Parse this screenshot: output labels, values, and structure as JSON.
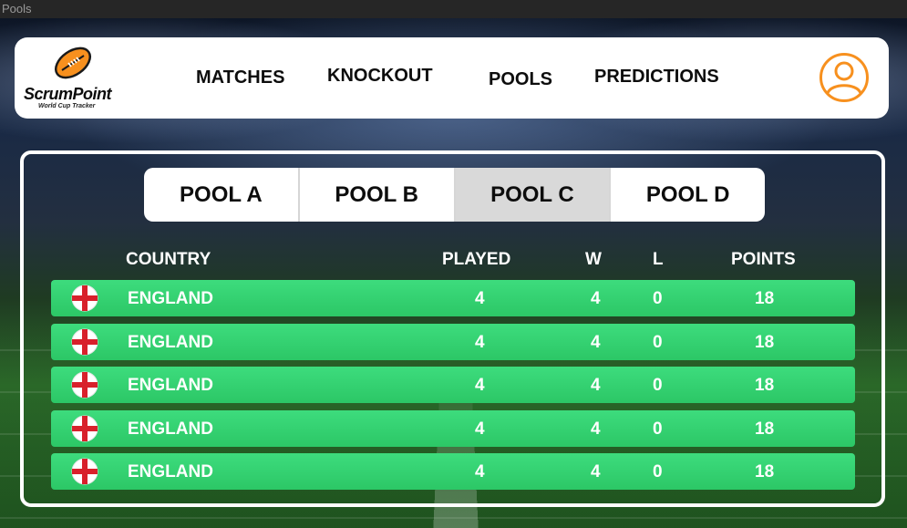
{
  "window": {
    "title": "Pools"
  },
  "brand": {
    "name": "ScrumPoint",
    "tagline": "World Cup Tracker"
  },
  "nav": {
    "items": [
      {
        "label": "MATCHES"
      },
      {
        "label": "KNOCKOUT"
      },
      {
        "label": "POOLS"
      },
      {
        "label": "PREDICTIONS"
      }
    ],
    "active": "POOLS"
  },
  "pools": {
    "tabs": [
      {
        "label": "POOL A"
      },
      {
        "label": "POOL B"
      },
      {
        "label": "POOL C"
      },
      {
        "label": "POOL D"
      }
    ],
    "selected": "POOL C"
  },
  "table": {
    "headers": {
      "country": "COUNTRY",
      "played": "PLAYED",
      "w": "W",
      "l": "L",
      "points": "POINTS"
    },
    "rows": [
      {
        "flag": "england-flag-icon",
        "country": "ENGLAND",
        "played": "4",
        "w": "4",
        "l": "0",
        "points": "18"
      },
      {
        "flag": "england-flag-icon",
        "country": "ENGLAND",
        "played": "4",
        "w": "4",
        "l": "0",
        "points": "18"
      },
      {
        "flag": "england-flag-icon",
        "country": "ENGLAND",
        "played": "4",
        "w": "4",
        "l": "0",
        "points": "18"
      },
      {
        "flag": "england-flag-icon",
        "country": "ENGLAND",
        "played": "4",
        "w": "4",
        "l": "0",
        "points": "18"
      },
      {
        "flag": "england-flag-icon",
        "country": "ENGLAND",
        "played": "4",
        "w": "4",
        "l": "0",
        "points": "18"
      }
    ]
  },
  "colors": {
    "accent": "#f7901e",
    "row": "#34d371",
    "active_tab": "#d9d9d9"
  },
  "icons": {
    "logo": "rugby-ball-icon",
    "profile": "user-profile-icon"
  }
}
